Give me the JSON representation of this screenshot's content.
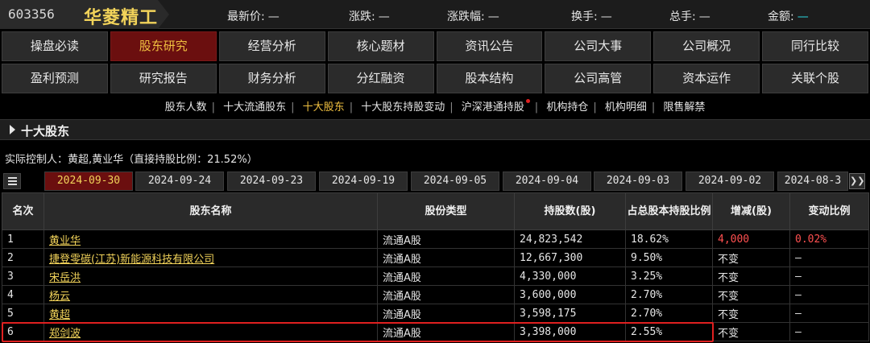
{
  "header": {
    "code": "603356",
    "name": "华菱精工",
    "quotes": [
      {
        "label": "最新价:",
        "value": "—"
      },
      {
        "label": "涨跌:",
        "value": "—"
      },
      {
        "label": "涨跌幅:",
        "value": "—"
      },
      {
        "label": "换手:",
        "value": "—"
      },
      {
        "label": "总手:",
        "value": "—"
      },
      {
        "label": "金额:",
        "value": "—"
      }
    ]
  },
  "nav": {
    "row1": [
      "操盘必读",
      "股东研究",
      "经营分析",
      "核心题材",
      "资讯公告",
      "公司大事",
      "公司概况",
      "同行比较"
    ],
    "row2": [
      "盈利预测",
      "研究报告",
      "财务分析",
      "分红融资",
      "股本结构",
      "公司高管",
      "资本运作",
      "关联个股"
    ],
    "active": "股东研究"
  },
  "sublinks": [
    "股东人数",
    "十大流通股东",
    "十大股东",
    "十大股东持股变动",
    "沪深港通持股",
    "机构持仓",
    "机构明细",
    "限售解禁"
  ],
  "sublink_active": "十大股东",
  "section": {
    "title": "十大股东"
  },
  "controller": "实际控制人：黄超,黄业华（直接持股比例：21.52%）",
  "date_tabs": [
    "2024-09-30",
    "2024-09-24",
    "2024-09-23",
    "2024-09-19",
    "2024-09-05",
    "2024-09-04",
    "2024-09-03",
    "2024-09-02",
    "2024-08-3"
  ],
  "date_active": "2024-09-30",
  "table": {
    "headers": [
      "名次",
      "股东名称",
      "股份类型",
      "持股数(股)",
      "占总股本持股比例",
      "增减(股)",
      "变动比例"
    ],
    "rows": [
      {
        "rank": "1",
        "name": "黄业华",
        "type": "流通A股",
        "shares": "24,823,542",
        "ratio": "18.62%",
        "change": "4,000",
        "change_ratio": "0.02%"
      },
      {
        "rank": "2",
        "name": "捷登零碳(江苏)新能源科技有限公司",
        "type": "流通A股",
        "shares": "12,667,300",
        "ratio": "9.50%",
        "change": "不变",
        "change_ratio": "—"
      },
      {
        "rank": "3",
        "name": "宋岳洪",
        "type": "流通A股",
        "shares": "4,330,000",
        "ratio": "3.25%",
        "change": "不变",
        "change_ratio": "—"
      },
      {
        "rank": "4",
        "name": "杨云",
        "type": "流通A股",
        "shares": "3,600,000",
        "ratio": "2.70%",
        "change": "不变",
        "change_ratio": "—"
      },
      {
        "rank": "5",
        "name": "黄超",
        "type": "流通A股",
        "shares": "3,598,175",
        "ratio": "2.70%",
        "change": "不变",
        "change_ratio": "—"
      },
      {
        "rank": "6",
        "name": "郑剑波",
        "type": "流通A股",
        "shares": "3,398,000",
        "ratio": "2.55%",
        "change": "不变",
        "change_ratio": "—"
      }
    ]
  },
  "colors": {
    "accent_gold": "#f2d35a",
    "active_bg": "#6b0f0f",
    "up_red": "#ff5050",
    "highlight_box": "#e02020",
    "cyan": "#2ad8e0"
  }
}
